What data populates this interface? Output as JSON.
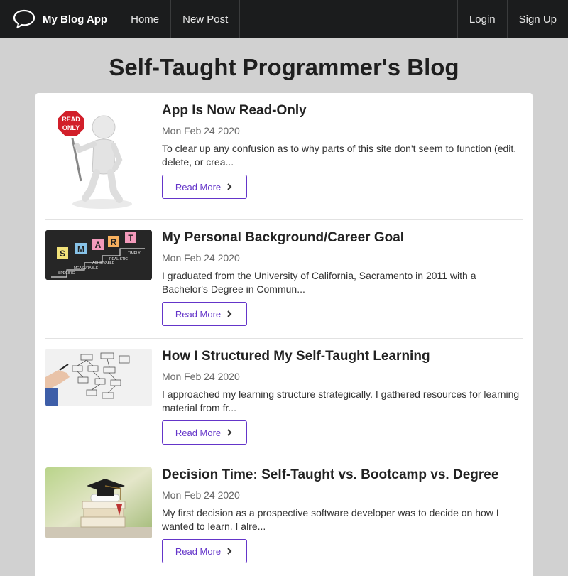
{
  "navbar": {
    "brand": "My Blog App",
    "left_items": [
      "Home",
      "New Post"
    ],
    "right_items": [
      "Login",
      "Sign Up"
    ]
  },
  "page": {
    "title": "Self-Taught Programmer's Blog"
  },
  "posts": [
    {
      "title": "App Is Now Read-Only",
      "date": "Mon Feb 24 2020",
      "excerpt": "To clear up any confusion as to why parts of this site don't seem to function (edit, delete, or crea...",
      "read_more": "Read More",
      "thumb_sign_text": [
        "READ",
        "ONLY"
      ]
    },
    {
      "title": "My Personal Background/Career Goal",
      "date": "Mon Feb 24 2020",
      "excerpt": "I graduated from the University of California, Sacramento in 2011 with a Bachelor's Degree in Commun...",
      "read_more": "Read More",
      "thumb_letters": [
        "S",
        "M",
        "A",
        "R",
        "T"
      ],
      "thumb_words": [
        "TIMELY",
        "REALISTIC",
        "ACHIEVABLE",
        "MEASURABLE",
        "SPECIFIC"
      ]
    },
    {
      "title": "How I Structured My Self-Taught Learning",
      "date": "Mon Feb 24 2020",
      "excerpt": "I approached my learning structure strategically. I gathered resources for learning material from fr...",
      "read_more": "Read More"
    },
    {
      "title": "Decision Time: Self-Taught vs. Bootcamp vs. Degree",
      "date": "Mon Feb 24 2020",
      "excerpt": "My first decision as a prospective software developer was to decide on how I wanted to learn. I alre...",
      "read_more": "Read More"
    }
  ],
  "colors": {
    "accent": "#6435c9",
    "navbar_bg": "#1b1c1d",
    "page_bg": "#d1d1d1"
  },
  "icons": {
    "brand": "speech-bubble-icon",
    "read_more": "chevron-right-icon"
  }
}
